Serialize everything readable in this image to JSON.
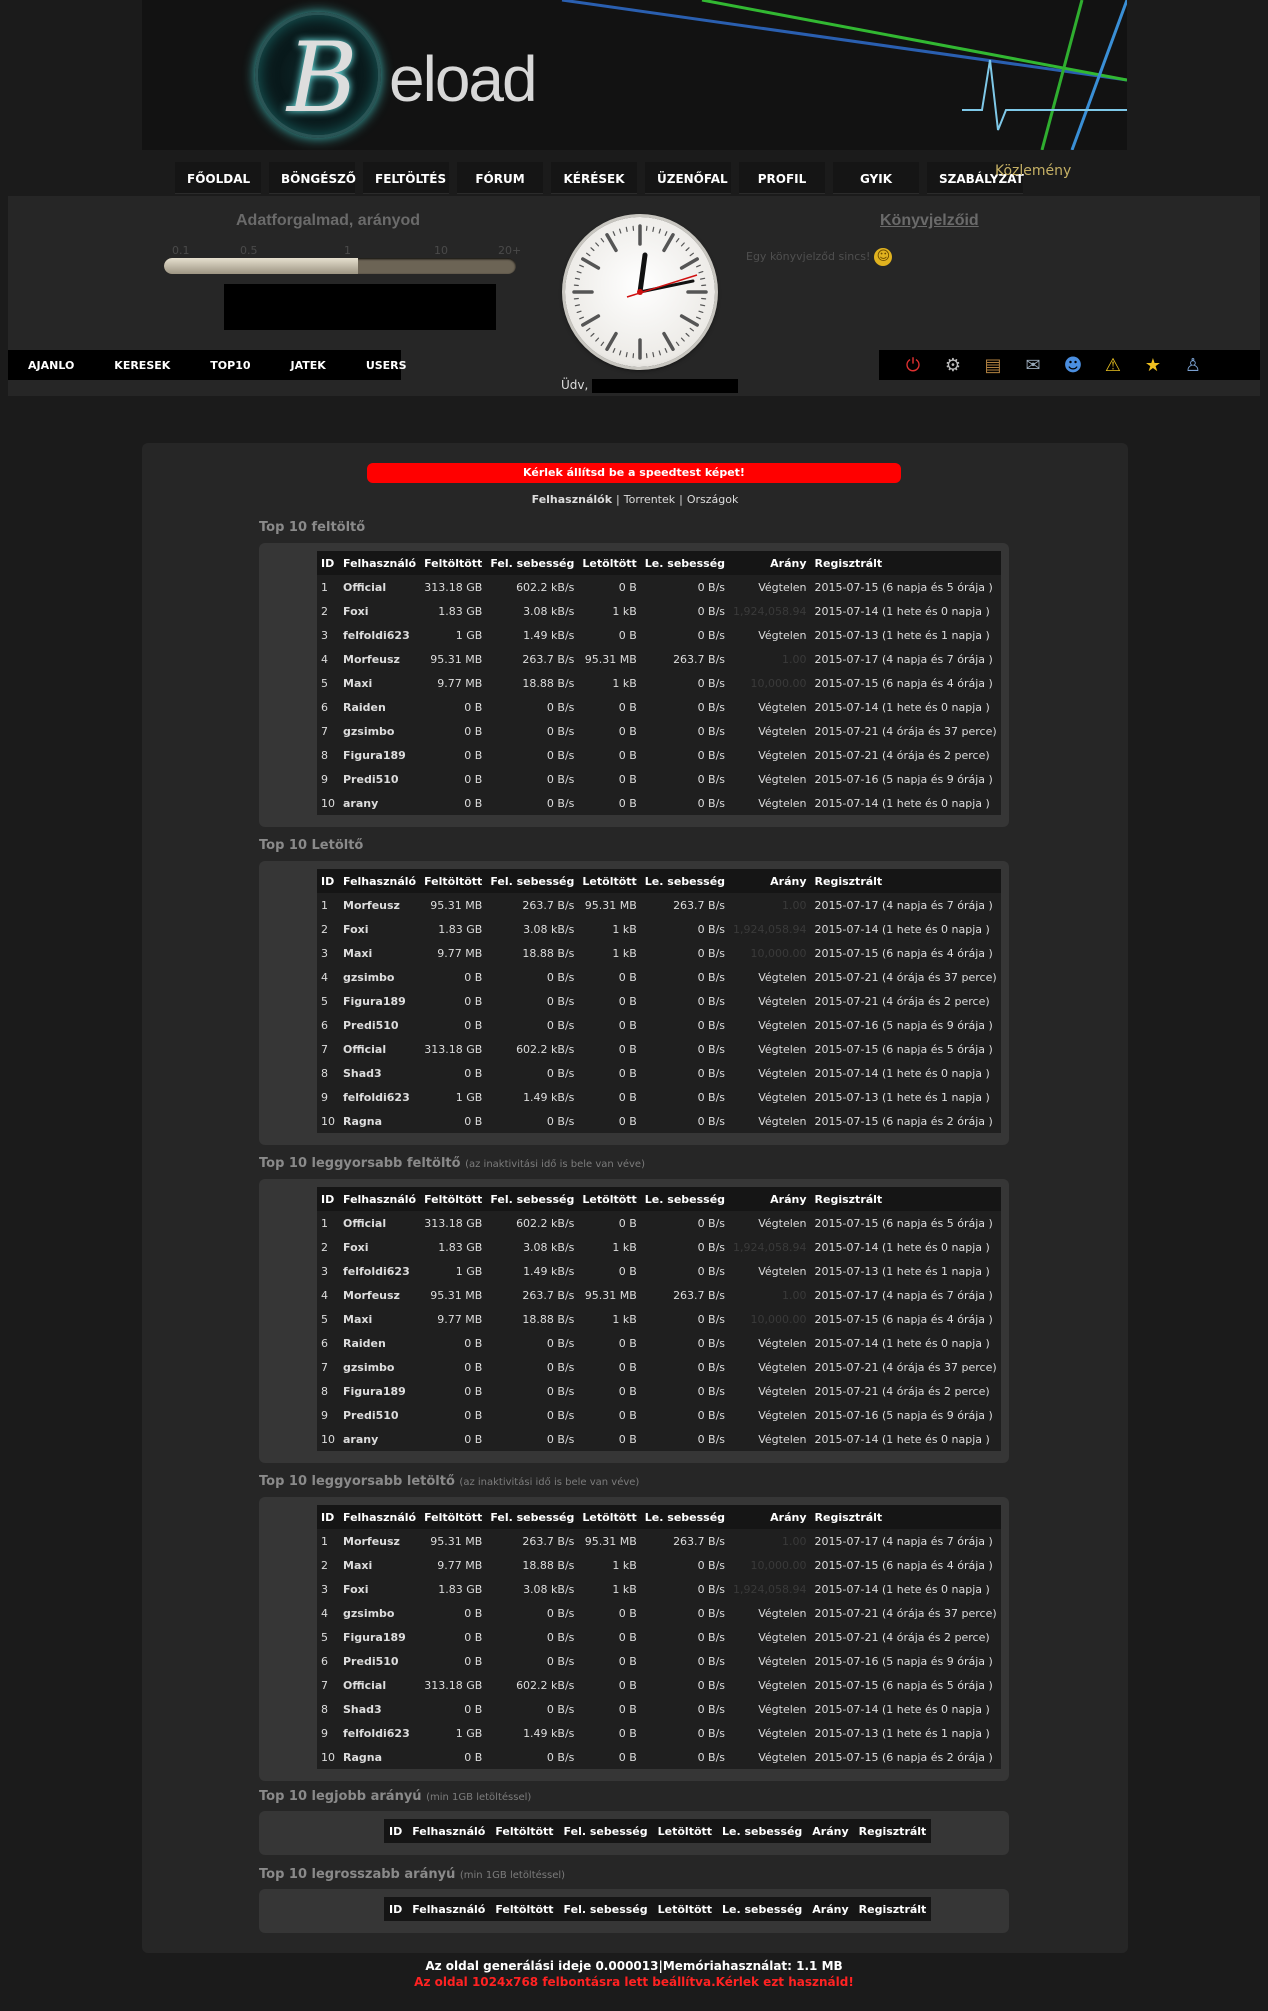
{
  "brand": {
    "logo_letter": "B",
    "logo_text": "eload"
  },
  "nav": [
    "FŐOLDAL",
    "BÖNGÉSZŐ",
    "FELTÖLTÉS",
    "FÓRUM",
    "KÉRÉSEK",
    "ÜZENŐFAL",
    "PROFIL",
    "GYIK",
    "SZABÁLYZAT"
  ],
  "kozlemeny": "Közlemény",
  "ratio_panel": {
    "title": "Adatforgalmad, arányod",
    "scale": [
      "0.1",
      "0.5",
      "1",
      "10",
      "20+"
    ],
    "level_fraction": 0.55
  },
  "bookmarks": {
    "title": "Könyvjelzőid",
    "empty_text": "Egy könyvjelződ sincs!"
  },
  "subnav": [
    "AJANLO",
    "KERESEK",
    "TOP10",
    "JATEK",
    "USERS"
  ],
  "icons": [
    "power-icon",
    "gear-icon",
    "scroll-icon",
    "mail-icon",
    "users-icon",
    "warning-icon",
    "star-icon",
    "user-icon"
  ],
  "greeting": "Üdv,",
  "alert": "Kérlek állítsd be a speedtest képet!",
  "tabs": [
    "Felhasználók",
    "Torrentek",
    "Országok"
  ],
  "tab_sep": "|",
  "columns": [
    "ID",
    "Felhasználó",
    "Feltöltött",
    "Fel. sebesség",
    "Letöltött",
    "Le. sebesség",
    "Arány",
    "Regisztrált"
  ],
  "sections": [
    {
      "title": "Top 10 feltöltő",
      "note": "",
      "rows": [
        [
          "1",
          "Official",
          "313.18 GB",
          "602.2 kB/s",
          "0 B",
          "0 B/s",
          "Végtelen",
          "2015-07-15 (6 napja és 5 órája )"
        ],
        [
          "2",
          "Foxi",
          "1.83 GB",
          "3.08 kB/s",
          "1 kB",
          "0 B/s",
          "1,924,058.94",
          "2015-07-14 (1 hete és 0 napja )"
        ],
        [
          "3",
          "felfoldi623",
          "1 GB",
          "1.49 kB/s",
          "0 B",
          "0 B/s",
          "Végtelen",
          "2015-07-13 (1 hete és 1 napja )"
        ],
        [
          "4",
          "Morfeusz",
          "95.31 MB",
          "263.7 B/s",
          "95.31 MB",
          "263.7 B/s",
          "1.00",
          "2015-07-17 (4 napja és 7 órája )"
        ],
        [
          "5",
          "Maxi",
          "9.77 MB",
          "18.88 B/s",
          "1 kB",
          "0 B/s",
          "10,000.00",
          "2015-07-15 (6 napja és 4 órája )"
        ],
        [
          "6",
          "Raiden",
          "0 B",
          "0 B/s",
          "0 B",
          "0 B/s",
          "Végtelen",
          "2015-07-14 (1 hete és 0 napja )"
        ],
        [
          "7",
          "gzsimbo",
          "0 B",
          "0 B/s",
          "0 B",
          "0 B/s",
          "Végtelen",
          "2015-07-21 (4 órája és 37 perce)"
        ],
        [
          "8",
          "Figura189",
          "0 B",
          "0 B/s",
          "0 B",
          "0 B/s",
          "Végtelen",
          "2015-07-21 (4 órája és 2 perce)"
        ],
        [
          "9",
          "Predi510",
          "0 B",
          "0 B/s",
          "0 B",
          "0 B/s",
          "Végtelen",
          "2015-07-16 (5 napja és 9 órája )"
        ],
        [
          "10",
          "arany",
          "0 B",
          "0 B/s",
          "0 B",
          "0 B/s",
          "Végtelen",
          "2015-07-14 (1 hete és 0 napja )"
        ]
      ]
    },
    {
      "title": "Top 10 Letöltő",
      "note": "",
      "rows": [
        [
          "1",
          "Morfeusz",
          "95.31 MB",
          "263.7 B/s",
          "95.31 MB",
          "263.7 B/s",
          "1.00",
          "2015-07-17 (4 napja és 7 órája )"
        ],
        [
          "2",
          "Foxi",
          "1.83 GB",
          "3.08 kB/s",
          "1 kB",
          "0 B/s",
          "1,924,058.94",
          "2015-07-14 (1 hete és 0 napja )"
        ],
        [
          "3",
          "Maxi",
          "9.77 MB",
          "18.88 B/s",
          "1 kB",
          "0 B/s",
          "10,000.00",
          "2015-07-15 (6 napja és 4 órája )"
        ],
        [
          "4",
          "gzsimbo",
          "0 B",
          "0 B/s",
          "0 B",
          "0 B/s",
          "Végtelen",
          "2015-07-21 (4 órája és 37 perce)"
        ],
        [
          "5",
          "Figura189",
          "0 B",
          "0 B/s",
          "0 B",
          "0 B/s",
          "Végtelen",
          "2015-07-21 (4 órája és 2 perce)"
        ],
        [
          "6",
          "Predi510",
          "0 B",
          "0 B/s",
          "0 B",
          "0 B/s",
          "Végtelen",
          "2015-07-16 (5 napja és 9 órája )"
        ],
        [
          "7",
          "Official",
          "313.18 GB",
          "602.2 kB/s",
          "0 B",
          "0 B/s",
          "Végtelen",
          "2015-07-15 (6 napja és 5 órája )"
        ],
        [
          "8",
          "Shad3",
          "0 B",
          "0 B/s",
          "0 B",
          "0 B/s",
          "Végtelen",
          "2015-07-14 (1 hete és 0 napja )"
        ],
        [
          "9",
          "felfoldi623",
          "1 GB",
          "1.49 kB/s",
          "0 B",
          "0 B/s",
          "Végtelen",
          "2015-07-13 (1 hete és 1 napja )"
        ],
        [
          "10",
          "Ragna",
          "0 B",
          "0 B/s",
          "0 B",
          "0 B/s",
          "Végtelen",
          "2015-07-15 (6 napja és 2 órája )"
        ]
      ]
    },
    {
      "title": "Top 10 leggyorsabb feltöltő",
      "note": "(az inaktivitási idő is bele van véve)",
      "rows": [
        [
          "1",
          "Official",
          "313.18 GB",
          "602.2 kB/s",
          "0 B",
          "0 B/s",
          "Végtelen",
          "2015-07-15 (6 napja és 5 órája )"
        ],
        [
          "2",
          "Foxi",
          "1.83 GB",
          "3.08 kB/s",
          "1 kB",
          "0 B/s",
          "1,924,058.94",
          "2015-07-14 (1 hete és 0 napja )"
        ],
        [
          "3",
          "felfoldi623",
          "1 GB",
          "1.49 kB/s",
          "0 B",
          "0 B/s",
          "Végtelen",
          "2015-07-13 (1 hete és 1 napja )"
        ],
        [
          "4",
          "Morfeusz",
          "95.31 MB",
          "263.7 B/s",
          "95.31 MB",
          "263.7 B/s",
          "1.00",
          "2015-07-17 (4 napja és 7 órája )"
        ],
        [
          "5",
          "Maxi",
          "9.77 MB",
          "18.88 B/s",
          "1 kB",
          "0 B/s",
          "10,000.00",
          "2015-07-15 (6 napja és 4 órája )"
        ],
        [
          "6",
          "Raiden",
          "0 B",
          "0 B/s",
          "0 B",
          "0 B/s",
          "Végtelen",
          "2015-07-14 (1 hete és 0 napja )"
        ],
        [
          "7",
          "gzsimbo",
          "0 B",
          "0 B/s",
          "0 B",
          "0 B/s",
          "Végtelen",
          "2015-07-21 (4 órája és 37 perce)"
        ],
        [
          "8",
          "Figura189",
          "0 B",
          "0 B/s",
          "0 B",
          "0 B/s",
          "Végtelen",
          "2015-07-21 (4 órája és 2 perce)"
        ],
        [
          "9",
          "Predi510",
          "0 B",
          "0 B/s",
          "0 B",
          "0 B/s",
          "Végtelen",
          "2015-07-16 (5 napja és 9 órája )"
        ],
        [
          "10",
          "arany",
          "0 B",
          "0 B/s",
          "0 B",
          "0 B/s",
          "Végtelen",
          "2015-07-14 (1 hete és 0 napja )"
        ]
      ]
    },
    {
      "title": "Top 10 leggyorsabb letöltő",
      "note": "(az inaktivitási idő is bele van véve)",
      "rows": [
        [
          "1",
          "Morfeusz",
          "95.31 MB",
          "263.7 B/s",
          "95.31 MB",
          "263.7 B/s",
          "1.00",
          "2015-07-17 (4 napja és 7 órája )"
        ],
        [
          "2",
          "Maxi",
          "9.77 MB",
          "18.88 B/s",
          "1 kB",
          "0 B/s",
          "10,000.00",
          "2015-07-15 (6 napja és 4 órája )"
        ],
        [
          "3",
          "Foxi",
          "1.83 GB",
          "3.08 kB/s",
          "1 kB",
          "0 B/s",
          "1,924,058.94",
          "2015-07-14 (1 hete és 0 napja )"
        ],
        [
          "4",
          "gzsimbo",
          "0 B",
          "0 B/s",
          "0 B",
          "0 B/s",
          "Végtelen",
          "2015-07-21 (4 órája és 37 perce)"
        ],
        [
          "5",
          "Figura189",
          "0 B",
          "0 B/s",
          "0 B",
          "0 B/s",
          "Végtelen",
          "2015-07-21 (4 órája és 2 perce)"
        ],
        [
          "6",
          "Predi510",
          "0 B",
          "0 B/s",
          "0 B",
          "0 B/s",
          "Végtelen",
          "2015-07-16 (5 napja és 9 órája )"
        ],
        [
          "7",
          "Official",
          "313.18 GB",
          "602.2 kB/s",
          "0 B",
          "0 B/s",
          "Végtelen",
          "2015-07-15 (6 napja és 5 órája )"
        ],
        [
          "8",
          "Shad3",
          "0 B",
          "0 B/s",
          "0 B",
          "0 B/s",
          "Végtelen",
          "2015-07-14 (1 hete és 0 napja )"
        ],
        [
          "9",
          "felfoldi623",
          "1 GB",
          "1.49 kB/s",
          "0 B",
          "0 B/s",
          "Végtelen",
          "2015-07-13 (1 hete és 1 napja )"
        ],
        [
          "10",
          "Ragna",
          "0 B",
          "0 B/s",
          "0 B",
          "0 B/s",
          "Végtelen",
          "2015-07-15 (6 napja és 2 órája )"
        ]
      ]
    }
  ],
  "empty_sections": [
    {
      "title": "Top 10 legjobb arányú",
      "note": "(min 1GB letöltéssel)"
    },
    {
      "title": "Top 10 legrosszabb arányú",
      "note": "(min 1GB letöltéssel)"
    }
  ],
  "footer": {
    "generation": "Az oldal generálási ideje 0.000013|Memóriahasználat: 1.1 MB",
    "resolution": "Az oldal 1024x768 felbontásra lett beállítva.Kérlek ezt használd!"
  },
  "colors": {
    "accent": "#ff0000",
    "gold": "#c5b065",
    "background": "#1b1b1b"
  }
}
